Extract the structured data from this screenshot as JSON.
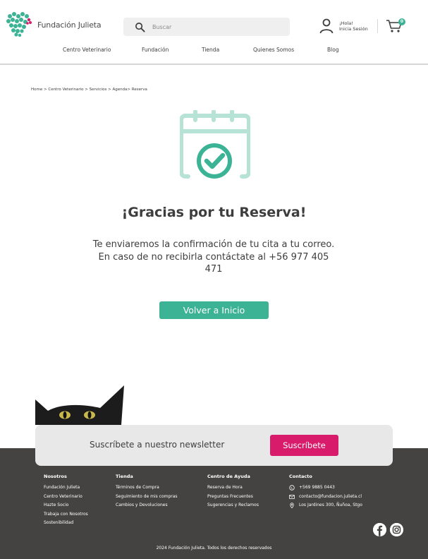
{
  "colors": {
    "accent": "#3bb394",
    "subscribe": "#d81b6a",
    "footer_bg": "#444342",
    "calendar_light": "#b7e3d6"
  },
  "header": {
    "logo_text": "Fundación Julieta",
    "search_placeholder": "Buscar",
    "greeting": "¡Hola!",
    "login": "Inicia Sesión",
    "cart_count": "0",
    "nav": [
      "Centro Veterinario",
      "Fundación",
      "Tienda",
      "Quienes Somos",
      "Blog"
    ]
  },
  "breadcrumb": "Home > Centro Veterinario > Servicios > Agenda> Reserva",
  "main": {
    "title": "¡Gracias por tu Reserva!",
    "message": "Te enviaremos la confirmación de tu cita a tu correo. En caso de no recibirla contáctate al +56 977 405 471",
    "button": "Volver a Inicio"
  },
  "newsletter": {
    "text": "Suscríbete a nuestro newsletter",
    "button": "Suscríbete"
  },
  "footer": {
    "nosotros": {
      "title": "Nosotros",
      "links": [
        "Fundación Julieta",
        "Centro Veterinario",
        "Hazte Socio",
        "Trabaja con Nosotros",
        "Sostenibilidad"
      ]
    },
    "tienda": {
      "title": "Tienda",
      "links": [
        "Términos de Compra",
        "Seguimiento de mis compras",
        "Cambios y Devoluciones"
      ]
    },
    "ayuda": {
      "title": "Centro de Ayuda",
      "links": [
        "Reserva de Hora",
        "Preguntas Frecuentes",
        "Sugerencias y Reclamos"
      ]
    },
    "contacto": {
      "title": "Contacto",
      "phone": "+569 9885 0443",
      "email": "contacto@fundacion.julieta.cl",
      "address": "Los Jardines 300, Ñuñoa, Stgo"
    },
    "copyright": "2024 Fundación Julieta. Todos los derechos reservados"
  },
  "icons": [
    "logo-hearts-icon",
    "search-icon",
    "user-icon",
    "cart-icon",
    "calendar-check-icon",
    "whatsapp-icon",
    "mail-icon",
    "location-icon",
    "facebook-icon",
    "instagram-icon"
  ]
}
